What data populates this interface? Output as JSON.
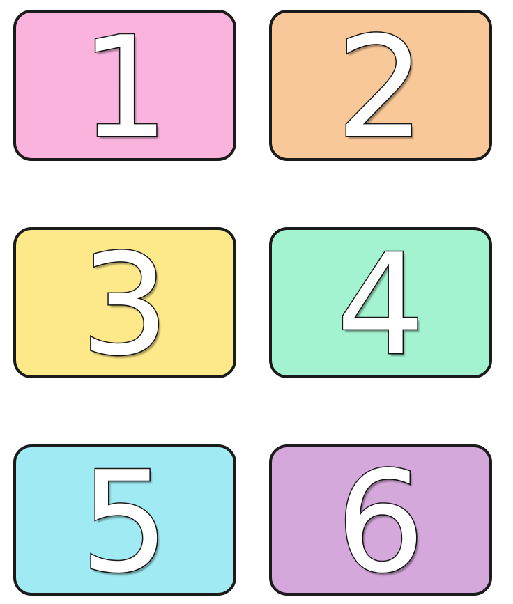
{
  "cards": [
    {
      "label": "1",
      "color": "#f9b3dd"
    },
    {
      "label": "2",
      "color": "#f8c898"
    },
    {
      "label": "3",
      "color": "#fde98a"
    },
    {
      "label": "4",
      "color": "#a4f3d0"
    },
    {
      "label": "5",
      "color": "#9feaf3"
    },
    {
      "label": "6",
      "color": "#d4a8da"
    }
  ]
}
